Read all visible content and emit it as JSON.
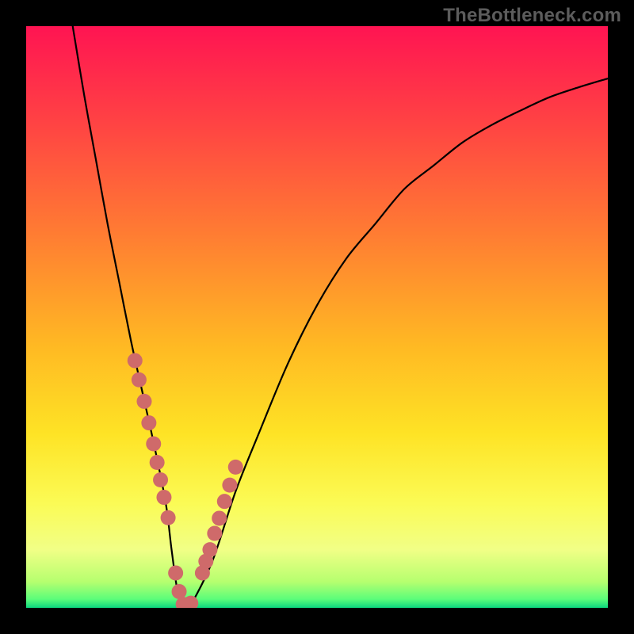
{
  "watermark": "TheBottleneck.com",
  "colors": {
    "frame": "#000000",
    "gradient_stops": [
      {
        "offset": 0.0,
        "color": "#ff1452"
      },
      {
        "offset": 0.15,
        "color": "#ff3e45"
      },
      {
        "offset": 0.35,
        "color": "#ff7a33"
      },
      {
        "offset": 0.55,
        "color": "#ffb923"
      },
      {
        "offset": 0.7,
        "color": "#fee325"
      },
      {
        "offset": 0.82,
        "color": "#fbfb55"
      },
      {
        "offset": 0.9,
        "color": "#f1ff86"
      },
      {
        "offset": 0.955,
        "color": "#b6ff6f"
      },
      {
        "offset": 0.985,
        "color": "#5cfd7a"
      },
      {
        "offset": 1.0,
        "color": "#0cd67f"
      }
    ],
    "curve": "#000000",
    "points": "#cf6a6a"
  },
  "chart_data": {
    "type": "line",
    "title": "",
    "xlabel": "",
    "ylabel": "",
    "xlim": [
      0,
      100
    ],
    "ylim": [
      0,
      100
    ],
    "grid": false,
    "series": [
      {
        "name": "bottleneck-curve",
        "x": [
          8,
          10,
          12,
          14,
          16,
          18,
          20,
          22,
          24,
          25,
          26,
          27,
          28,
          32,
          36,
          40,
          45,
          50,
          55,
          60,
          65,
          70,
          75,
          80,
          85,
          90,
          95,
          100
        ],
        "values": [
          100,
          88,
          77,
          66,
          56,
          46,
          37,
          28,
          18,
          10,
          3,
          0,
          0,
          8,
          20,
          30,
          42,
          52,
          60,
          66,
          72,
          76,
          80,
          83,
          85.5,
          87.8,
          89.5,
          91
        ]
      }
    ],
    "highlight_points": {
      "name": "focus-dots",
      "x": [
        18.7,
        19.4,
        20.3,
        21.1,
        21.9,
        22.5,
        23.1,
        23.7,
        24.4,
        25.7,
        26.3,
        27.0,
        27.6,
        28.3,
        30.3,
        30.9,
        31.6,
        32.4,
        33.2,
        34.1,
        35.0,
        36.0
      ],
      "values": [
        42.5,
        39.2,
        35.5,
        31.8,
        28.2,
        25.0,
        22.0,
        19.0,
        15.5,
        6.0,
        2.8,
        0.6,
        0.5,
        0.8,
        6.0,
        8.0,
        10.0,
        12.8,
        15.4,
        18.3,
        21.1,
        24.2
      ]
    }
  }
}
